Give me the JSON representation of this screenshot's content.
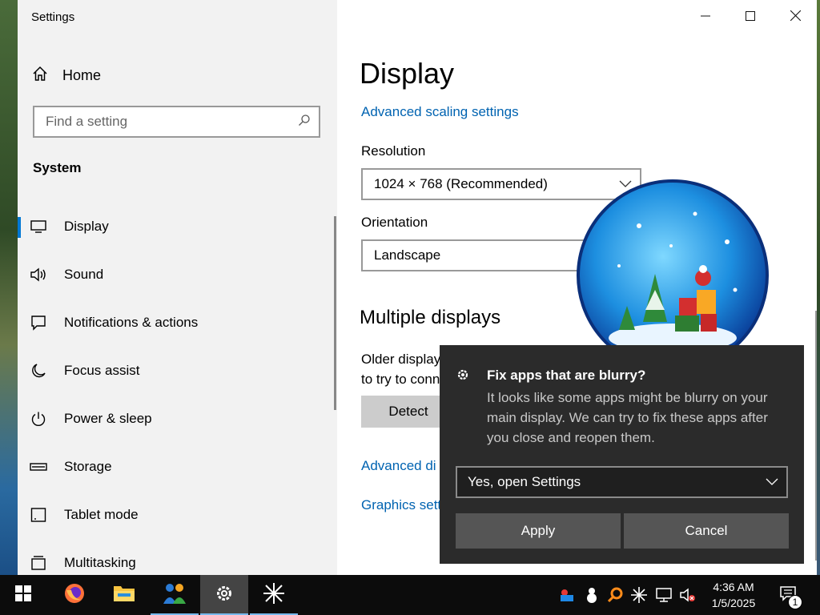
{
  "window": {
    "title": "Settings",
    "caption": {
      "minimize_icon": "minimize-icon",
      "maximize_icon": "maximize-icon",
      "close_icon": "close-icon"
    }
  },
  "sidebar": {
    "home_label": "Home",
    "search_placeholder": "Find a setting",
    "section_title": "System",
    "items": [
      {
        "label": "Display",
        "icon": "monitor-icon",
        "active": true
      },
      {
        "label": "Sound",
        "icon": "speaker-icon"
      },
      {
        "label": "Notifications & actions",
        "icon": "notification-icon"
      },
      {
        "label": "Focus assist",
        "icon": "moon-icon"
      },
      {
        "label": "Power & sleep",
        "icon": "power-icon"
      },
      {
        "label": "Storage",
        "icon": "storage-icon"
      },
      {
        "label": "Tablet mode",
        "icon": "tablet-icon"
      },
      {
        "label": "Multitasking",
        "icon": "multitasking-icon"
      }
    ]
  },
  "main": {
    "title": "Display",
    "advanced_scaling_link": "Advanced scaling settings",
    "resolution_label": "Resolution",
    "resolution_value": "1024 × 768 (Recommended)",
    "orientation_label": "Orientation",
    "orientation_value": "Landscape",
    "multiple_displays_heading": "Multiple displays",
    "older_displays_text_1": "Older display",
    "older_displays_text_2": "to try to conn",
    "detect_label": "Detect",
    "advanced_display_link": "Advanced di",
    "graphics_link": "Graphics sett"
  },
  "toast": {
    "title": "Fix apps that are blurry?",
    "body": "It looks like some apps might be blurry on your main display. We can try to fix these apps after you close and reopen them.",
    "select_value": "Yes, open Settings",
    "apply_label": "Apply",
    "cancel_label": "Cancel"
  },
  "taskbar": {
    "items": [
      "start-icon",
      "firefox-icon",
      "file-explorer-icon",
      "people-app-icon",
      "settings-icon",
      "snowflake-app-icon"
    ],
    "time": "4:36 AM",
    "date": "1/5/2025",
    "notification_count": "1"
  },
  "colors": {
    "accent": "#0078d4",
    "link": "#0063b1",
    "toast_bg": "#2b2b2b",
    "taskbar_bg": "#0c0c0c"
  }
}
